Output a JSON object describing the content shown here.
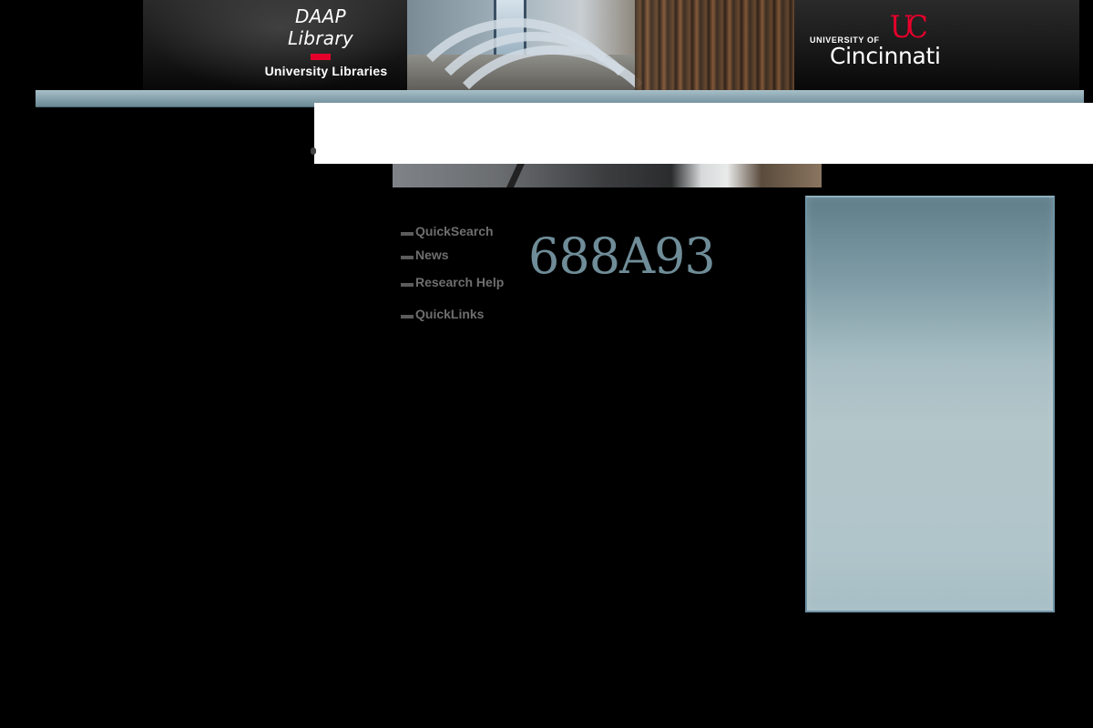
{
  "header": {
    "library_name_line1": "DAAP",
    "library_name_line2": "Library",
    "library_sub": "University  Libraries",
    "uc_small": "UNIVERSITY OF",
    "uc_mark": "UC",
    "uc_big": "Cincinnati"
  },
  "nav": {
    "items": [
      {
        "label": "QuickSearch"
      },
      {
        "label": "News"
      },
      {
        "label": "Research Help"
      },
      {
        "label": "QuickLinks"
      }
    ]
  },
  "main": {
    "code_text": "688A93"
  },
  "colors": {
    "brand_red": "#e4002b",
    "teal": "#8ba6b1",
    "nav_text": "#6e6e6e",
    "code_text": "#6f8d98"
  }
}
